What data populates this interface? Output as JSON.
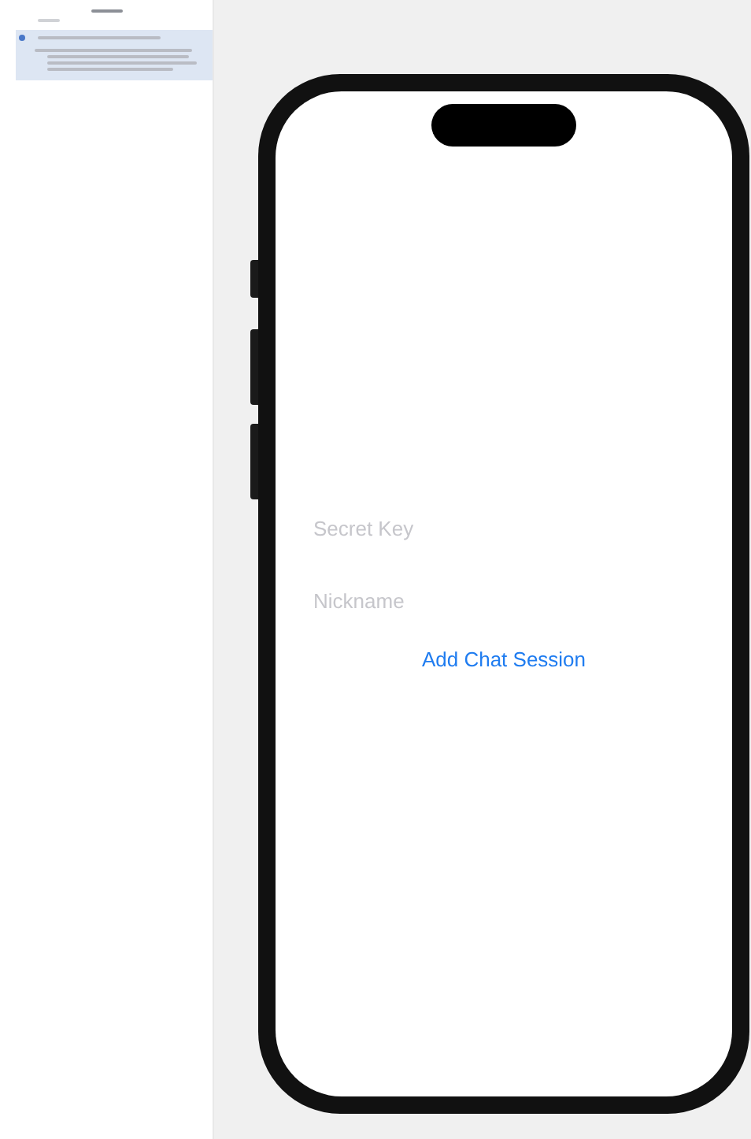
{
  "form": {
    "fields": [
      {
        "placeholder": "Secret Key"
      },
      {
        "placeholder": "Nickname"
      }
    ],
    "button": "Add Chat Session"
  }
}
